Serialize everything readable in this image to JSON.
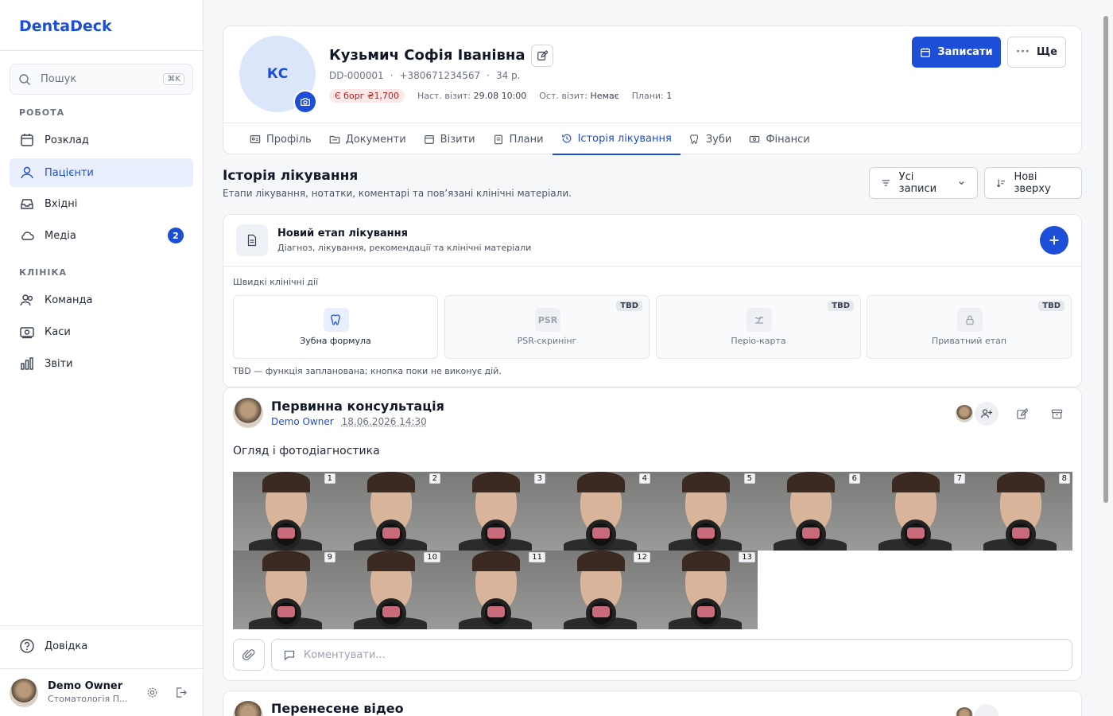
{
  "brand": "DentaDeck",
  "search": {
    "placeholder": "Пошук",
    "shortcut": "⌘K"
  },
  "sidebar": {
    "section_work": "РОБОТА",
    "section_clinic": "КЛІНІКА",
    "items": [
      {
        "label": "Розклад"
      },
      {
        "label": "Пацієнти"
      },
      {
        "label": "Вхідні"
      },
      {
        "label": "Медіа",
        "badge": "2"
      },
      {
        "label": "Команда"
      },
      {
        "label": "Каси"
      },
      {
        "label": "Звіти"
      }
    ],
    "help": "Довідка",
    "user_name": "Demo Owner",
    "user_org": "Стоматологія П..."
  },
  "patient": {
    "initials": "КС",
    "name": "Кузьмич Софія Іванівна",
    "id": "DD-000001",
    "phone": "+380671234567",
    "age": "34 р.",
    "debt": "Є борг ₴1,700",
    "next_visit_label": "Наст. візит:",
    "next_visit": "29.08 10:00",
    "last_visit_label": "Ост. візит:",
    "last_visit": "Немає",
    "plans_label": "Плани:",
    "plans": "1"
  },
  "header_buttons": {
    "book": "Записати",
    "more": "Ще"
  },
  "tabs": [
    "Профіль",
    "Документи",
    "Візити",
    "Плани",
    "Історія лікування",
    "Зуби",
    "Фінанси"
  ],
  "section": {
    "title": "Історія лікування",
    "subtitle": "Етапи лікування, нотатки, коментарі та пов’язані клінічні матеріали.",
    "filter": "Усі записи",
    "sort": "Нові зверху"
  },
  "new_stage": {
    "title": "Новий етап лікування",
    "subtitle": "Діагноз, лікування, рекомендації та клінічні матеріали",
    "quick_label": "Швидкі клінічні дії",
    "actions": [
      {
        "label": "Зубна формула",
        "icon": "tooth-icon"
      },
      {
        "label": "PSR-скринінг",
        "icon_text": "PSR",
        "tag": "TBD"
      },
      {
        "label": "Періо-карта",
        "icon": "perio-icon",
        "tag": "TBD"
      },
      {
        "label": "Приватний етап",
        "icon": "lock-icon",
        "tag": "TBD"
      }
    ],
    "note": "TBD — функція запланована; кнопка поки не виконує дій."
  },
  "entry": {
    "title": "Первинна консультація",
    "author": "Demo Owner",
    "datetime": "18.06.2026 14:30",
    "text": "Огляд і фотодіагностика",
    "photos": [
      "1",
      "2",
      "3",
      "4",
      "5",
      "6",
      "7",
      "8",
      "9",
      "10",
      "11",
      "12",
      "13"
    ],
    "comment_placeholder": "Коментувати..."
  },
  "entry2": {
    "title": "Перенесене відео"
  },
  "colors": {
    "accent": "#1d4ed8",
    "debt_bg": "#fde8e8",
    "debt_text": "#b91c1c"
  }
}
